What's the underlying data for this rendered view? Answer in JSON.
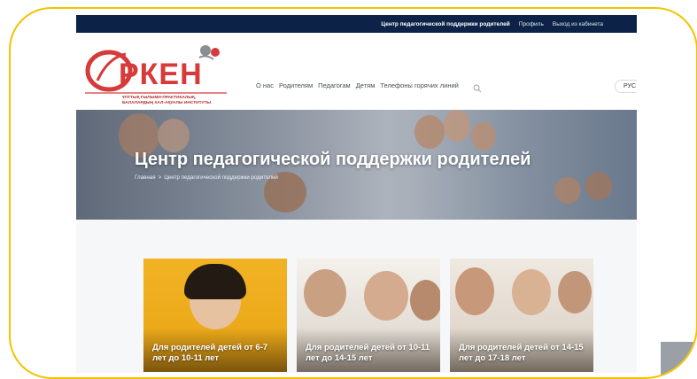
{
  "topbar": {
    "links": [
      "Центр педагогической поддержки родителей",
      "Профиль",
      "Выход из кабинета"
    ]
  },
  "logo": {
    "title": "РКЕН",
    "subtitle_line1": "ҰЛТТЫҚ ҒЫЛЫМИ-ПРАКТИКАЛЫҚ,",
    "subtitle_line2": "БАЛАЛАРДЫҢ ХАЛ-АҚУАЛЫ ИНСТИТУТЫ"
  },
  "nav": {
    "items": [
      "О нас",
      "Родителям",
      "Педагогам",
      "Детям",
      "Телефоны горячих линий"
    ],
    "lang_label": "РУС"
  },
  "hero": {
    "title": "Центр педагогической поддержки родителей",
    "breadcrumb": [
      "Главная",
      ">",
      "Центр педагогической поддержки родителей"
    ]
  },
  "cards": [
    {
      "label": "Для родителей детей от 6-7 лет до 10-11 лет"
    },
    {
      "label": "Для родителей детей от 10-11 лет до 14-15 лет"
    },
    {
      "label": "Для родителей детей от 14-15 лет до 17-18 лет"
    }
  ],
  "colors": {
    "frame_border": "#f3c300",
    "topbar_bg": "#0c2347",
    "brand_red": "#d63a3a",
    "card1_bg": "#f1b324"
  },
  "icons": {
    "search": "search-icon",
    "logo_leaf": "leaf-icon"
  }
}
